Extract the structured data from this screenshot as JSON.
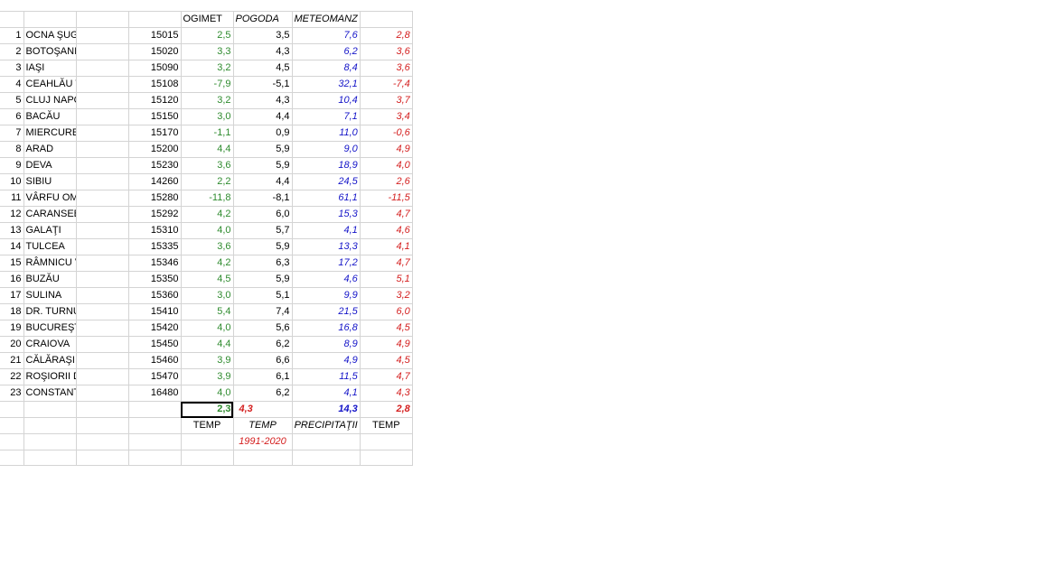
{
  "headers": {
    "ogimet": "OGIMET",
    "pogoda": "POGODA",
    "meteomanz": "METEOMANZ"
  },
  "rows": [
    {
      "n": "1",
      "city": "OCNA ŞUGATAG",
      "code": "15015",
      "ogimet": "2,5",
      "pogoda": "3,5",
      "prec": "7,6",
      "temp": "2,8"
    },
    {
      "n": "2",
      "city": "BOTOŞANI",
      "code": "15020",
      "ogimet": "3,3",
      "pogoda": "4,3",
      "prec": "6,2",
      "temp": "3,6"
    },
    {
      "n": "3",
      "city": "IAŞI",
      "code": "15090",
      "ogimet": "3,2",
      "pogoda": "4,5",
      "prec": "8,4",
      "temp": "3,6"
    },
    {
      "n": "4",
      "city": "CEAHLĂU TOACA",
      "code": "15108",
      "ogimet": "-7,9",
      "pogoda": "-5,1",
      "prec": "32,1",
      "temp": "-7,4"
    },
    {
      "n": "5",
      "city": "CLUJ NAPOCA",
      "code": "15120",
      "ogimet": "3,2",
      "pogoda": "4,3",
      "prec": "10,4",
      "temp": "3,7"
    },
    {
      "n": "6",
      "city": "BACĂU",
      "code": "15150",
      "ogimet": "3,0",
      "pogoda": "4,4",
      "prec": "7,1",
      "temp": "3,4"
    },
    {
      "n": "7",
      "city": "MIERCUREA CIUC",
      "code": "15170",
      "ogimet": "-1,1",
      "pogoda": "0,9",
      "prec": "11,0",
      "temp": "-0,6"
    },
    {
      "n": "8",
      "city": "ARAD",
      "code": "15200",
      "ogimet": "4,4",
      "pogoda": "5,9",
      "prec": "9,0",
      "temp": "4,9"
    },
    {
      "n": "9",
      "city": "DEVA",
      "code": "15230",
      "ogimet": "3,6",
      "pogoda": "5,9",
      "prec": "18,9",
      "temp": "4,0"
    },
    {
      "n": "10",
      "city": "SIBIU",
      "code": "14260",
      "ogimet": "2,2",
      "pogoda": "4,4",
      "prec": "24,5",
      "temp": "2,6"
    },
    {
      "n": "11",
      "city": "VÂRFU OMU",
      "code": "15280",
      "ogimet": "-11,8",
      "pogoda": "-8,1",
      "prec": "61,1",
      "temp": "-11,5"
    },
    {
      "n": "12",
      "city": "CARANSEBEŞ",
      "code": "15292",
      "ogimet": "4,2",
      "pogoda": "6,0",
      "prec": "15,3",
      "temp": "4,7"
    },
    {
      "n": "13",
      "city": "GALAŢI",
      "code": "15310",
      "ogimet": "4,0",
      "pogoda": "5,7",
      "prec": "4,1",
      "temp": "4,6"
    },
    {
      "n": "14",
      "city": "TULCEA",
      "code": "15335",
      "ogimet": "3,6",
      "pogoda": "5,9",
      "prec": "13,3",
      "temp": "4,1"
    },
    {
      "n": "15",
      "city": "RÂMNICU VÂLCEA",
      "code": "15346",
      "ogimet": "4,2",
      "pogoda": "6,3",
      "prec": "17,2",
      "temp": "4,7"
    },
    {
      "n": "16",
      "city": "BUZĂU",
      "code": "15350",
      "ogimet": "4,5",
      "pogoda": "5,9",
      "prec": "4,6",
      "temp": "5,1"
    },
    {
      "n": "17",
      "city": "SULINA",
      "code": "15360",
      "ogimet": "3,0",
      "pogoda": "5,1",
      "prec": "9,9",
      "temp": "3,2"
    },
    {
      "n": "18",
      "city": "DR. TURNU SEVERIN",
      "code": "15410",
      "ogimet": "5,4",
      "pogoda": "7,4",
      "prec": "21,5",
      "temp": "6,0"
    },
    {
      "n": "19",
      "city": "BUCUREŞTI BĂNEASA",
      "code": "15420",
      "ogimet": "4,0",
      "pogoda": "5,6",
      "prec": "16,8",
      "temp": "4,5"
    },
    {
      "n": "20",
      "city": "CRAIOVA",
      "code": "15450",
      "ogimet": "4,4",
      "pogoda": "6,2",
      "prec": "8,9",
      "temp": "4,9"
    },
    {
      "n": "21",
      "city": "CĂLĂRAŞI",
      "code": "15460",
      "ogimet": "3,9",
      "pogoda": "6,6",
      "prec": "4,9",
      "temp": "4,5"
    },
    {
      "n": "22",
      "city": "ROŞIORII DE VEDE",
      "code": "15470",
      "ogimet": "3,9",
      "pogoda": "6,1",
      "prec": "11,5",
      "temp": "4,7"
    },
    {
      "n": "23",
      "city": "CONSTANŢA",
      "code": "16480",
      "ogimet": "4,0",
      "pogoda": "6,2",
      "prec": "4,1",
      "temp": "4,3"
    }
  ],
  "averages": {
    "ogimet": "2,3",
    "pogoda": "4,3",
    "prec": "14,3",
    "temp": "2,8"
  },
  "footer": {
    "ogimet_label": "TEMP",
    "pogoda_label": "TEMP",
    "prec_label": "PRECIPITAŢII",
    "temp_label": "TEMP",
    "period": "1991-2020"
  },
  "colors": {
    "ogimet": "#2e8b2e",
    "precipitation": "#1515c8",
    "temperature": "#d42020",
    "gridline": "#d4d4d4"
  }
}
